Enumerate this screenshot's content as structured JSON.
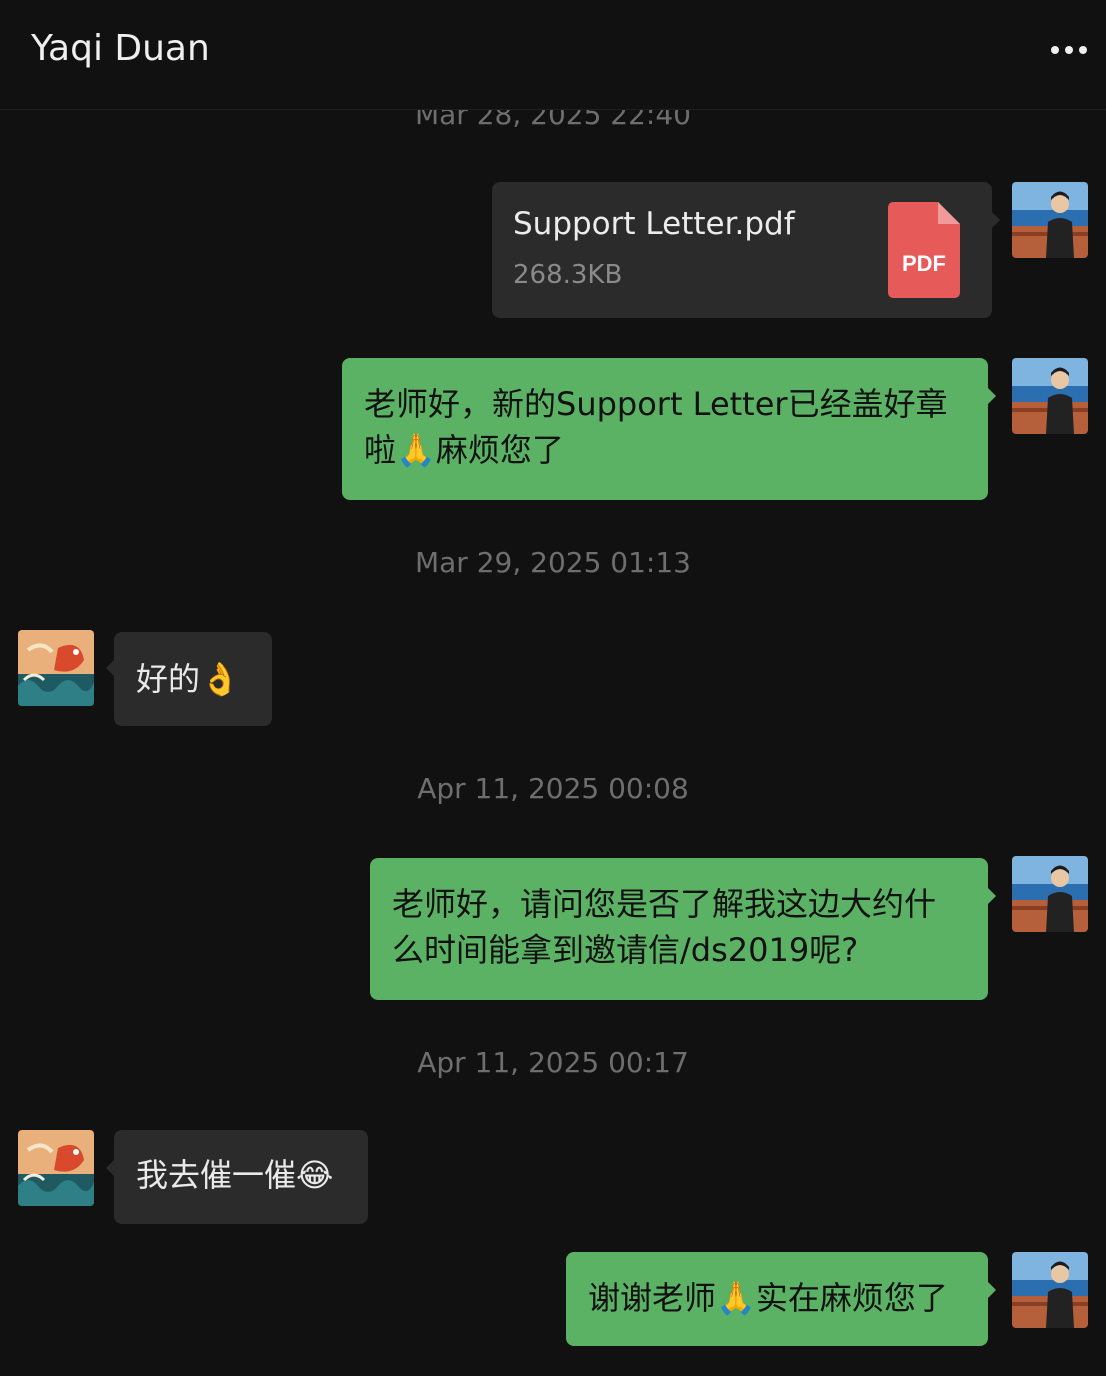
{
  "header": {
    "title": "Yaqi Duan",
    "more_icon": "more-dots-icon"
  },
  "colors": {
    "background": "#111111",
    "sent_bubble": "#5bb265",
    "received_bubble": "#2b2b2b",
    "timestamp": "#6e6e6e",
    "pdf_red": "#e65a5a"
  },
  "timestamps": [
    "Mar 28, 2025 22:40",
    "Mar 29, 2025 01:13",
    "Apr 11, 2025 00:08",
    "Apr 11, 2025 00:17"
  ],
  "messages": {
    "file": {
      "name": "Support Letter.pdf",
      "size": "268.3KB",
      "icon_label": "PDF"
    },
    "m1_line1": "老师好，新的Support Letter已经盖好章",
    "m1_line2": "啦🙏麻烦您了",
    "m2": "好的👌",
    "m3_line1": "老师好，请问您是否了解我这边大约什",
    "m3_line2": "么时间能拿到邀请信/ds2019呢?",
    "m4": "我去催一催😂",
    "m5": "谢谢老师🙏实在麻烦您了"
  }
}
